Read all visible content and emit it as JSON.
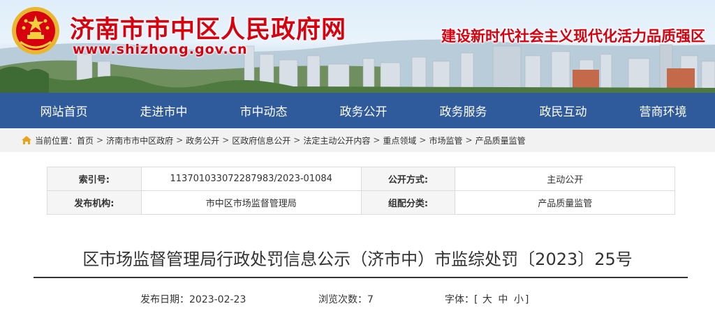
{
  "colors": {
    "brand_red": "#d7000f",
    "nav_blue": "#2f5a9c",
    "crumb_bg": "#f2f2f2"
  },
  "header": {
    "title": "济南市市中区人民政府网",
    "url": "www.shizhong.gov.cn",
    "slogan": "建设新时代社会主义现代化活力品质强区",
    "emblem_icon": "national-emblem-icon"
  },
  "nav": {
    "items": [
      "网站首页",
      "走进市中",
      "市中动态",
      "政务公开",
      "政务服务",
      "政民互动",
      "营商环境"
    ]
  },
  "breadcrumb": {
    "prefix": "当前位置：",
    "items": [
      "首页",
      "济南市市中区政府",
      "政务公开",
      "区政府信息公开",
      "法定主动公开内容",
      "重点领域",
      "市场监管",
      "产品质量监管"
    ],
    "separator": ">"
  },
  "info": {
    "index_label": "索引号:",
    "index_value": "113701033072287983/2023-01084",
    "method_label": "公开方式:",
    "method_value": "主动公开",
    "org_label": "发布机构:",
    "org_value": "市中区市场监督管理局",
    "category_label": "组配分类:",
    "category_value": "产品质量监管"
  },
  "article": {
    "title": "区市场监督管理局行政处罚信息公示（济市中）市监综处罚〔2023〕25号",
    "date_label": "发布日期：",
    "date": "2023-02-23",
    "views_label": "浏览次数：",
    "views": "7",
    "font_label": "字体：",
    "font_open": "[",
    "font_large": "大",
    "font_medium": "中",
    "font_small": "小",
    "font_close": "]"
  }
}
